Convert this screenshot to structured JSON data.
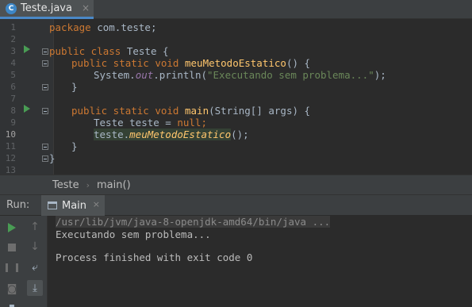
{
  "tab": {
    "label": "Teste.java",
    "icon": "C"
  },
  "code_lines": [
    {
      "n": "1"
    },
    {
      "n": "2"
    },
    {
      "n": "3"
    },
    {
      "n": "4"
    },
    {
      "n": "5"
    },
    {
      "n": "6"
    },
    {
      "n": "7"
    },
    {
      "n": "8"
    },
    {
      "n": "9"
    },
    {
      "n": "10"
    },
    {
      "n": "11"
    },
    {
      "n": "12"
    },
    {
      "n": "13"
    }
  ],
  "code": {
    "l1_kw": "package",
    "l1_rest": " com.teste;",
    "l3_kw": "public class",
    "l3_rest": " Teste {",
    "l4_kw": "public static void",
    "l4_fn": "meuMetodoEstatico",
    "l4_rest": "() {",
    "l5_a": "System.",
    "l5_out": "out",
    "l5_b": ".println(",
    "l5_str": "\"Executando sem problema...\"",
    "l5_c": ");",
    "l6": "}",
    "l8_kw": "public static void",
    "l8_fn": "main",
    "l8_rest": "(String[] args) {",
    "l9_a": "Teste teste = ",
    "l9_kw": "null",
    "l9_b": ";",
    "l10_a": "teste.",
    "l10_fn": "meuMetodoEstatico",
    "l10_b": "();",
    "l11": "}",
    "l12": "}"
  },
  "breadcrumb": {
    "class": "Teste",
    "method": "main()"
  },
  "run": {
    "title": "Run:",
    "tab_label": "Main",
    "console": {
      "command": "/usr/lib/jvm/java-8-openjdk-amd64/bin/java ...",
      "output": "Executando sem problema...",
      "exit": "Process finished with exit code 0"
    }
  },
  "colors": {
    "keyword": "#cc7832",
    "method": "#ffc66d",
    "string": "#6a8759",
    "field": "#9876aa",
    "run_green": "#499c54"
  }
}
